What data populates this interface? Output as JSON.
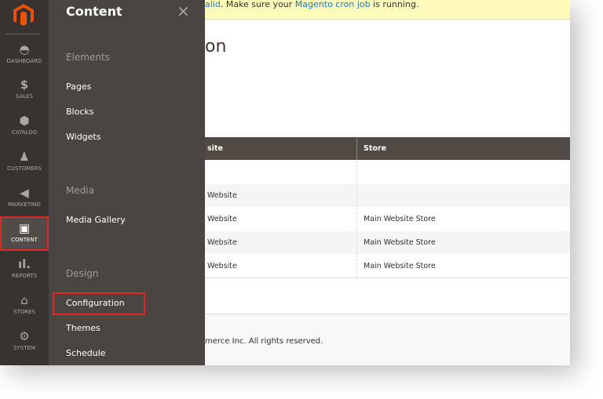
{
  "notice": {
    "prefix": "alid",
    "middle": ". Make sure your ",
    "link": "Magento cron job",
    "suffix": " is running."
  },
  "page_title": "on",
  "sidebar": {
    "items": [
      {
        "label": "DASHBOARD",
        "icon": "dashboard-icon"
      },
      {
        "label": "SALES",
        "icon": "dollar-icon"
      },
      {
        "label": "CATALOG",
        "icon": "box-icon"
      },
      {
        "label": "CUSTOMERS",
        "icon": "person-icon"
      },
      {
        "label": "MARKETING",
        "icon": "megaphone-icon"
      },
      {
        "label": "CONTENT",
        "icon": "layout-icon",
        "active": true
      },
      {
        "label": "REPORTS",
        "icon": "bar-chart-icon"
      },
      {
        "label": "STORES",
        "icon": "storefront-icon"
      },
      {
        "label": "SYSTEM",
        "icon": "gear-icon"
      }
    ]
  },
  "panel": {
    "title": "Content",
    "close": "×",
    "groups": [
      {
        "label": "Elements",
        "items": [
          "Pages",
          "Blocks",
          "Widgets"
        ]
      },
      {
        "label": "Media",
        "items": [
          "Media Gallery"
        ]
      },
      {
        "label": "Design",
        "items": [
          "Configuration",
          "Themes",
          "Schedule"
        ]
      }
    ]
  },
  "table": {
    "headers": [
      "site",
      "Store"
    ],
    "rows": [
      [
        "",
        ""
      ],
      [
        "Website",
        ""
      ],
      [
        "Website",
        "Main Website Store"
      ],
      [
        "Website",
        "Main Website Store"
      ],
      [
        "Website",
        "Main Website Store"
      ]
    ]
  },
  "footer": "merce Inc. All rights reserved.",
  "colors": {
    "accent": "#eb5202",
    "highlight": "#e22626"
  }
}
